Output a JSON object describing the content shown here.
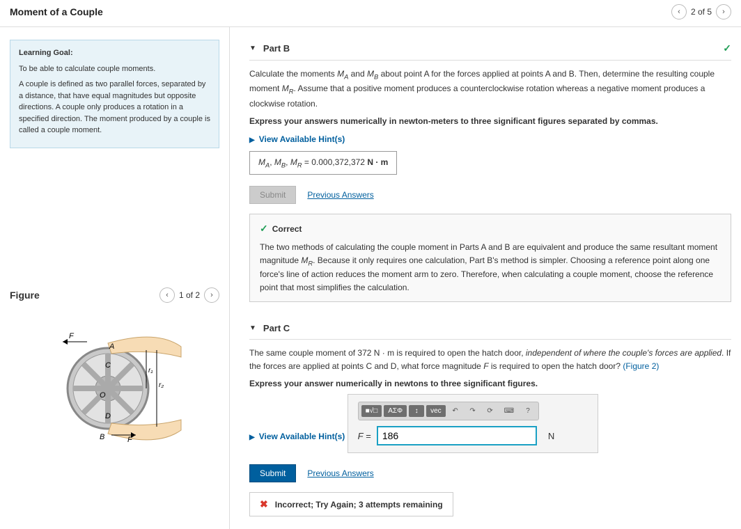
{
  "header": {
    "title": "Moment of a Couple",
    "pager": "2 of 5"
  },
  "learning_goal": {
    "title": "Learning Goal:",
    "goal": "To be able to calculate couple moments.",
    "desc": "A couple is defined as two parallel forces, separated by a distance, that have equal magnitudes but opposite directions. A couple only produces a rotation in a specified direction. The moment produced by a couple is called a couple moment."
  },
  "figure": {
    "title": "Figure",
    "pager": "1 of 2",
    "labels": {
      "F_top": "F",
      "A": "A",
      "C": "C",
      "O": "O",
      "D": "D",
      "B": "B",
      "F_bot": "F",
      "r1": "r₁",
      "r2": "r₂"
    }
  },
  "partB": {
    "label": "Part B",
    "instr_pre": "Calculate the moments ",
    "instr_mid1": " and ",
    "instr_mid2": " about point A for the forces applied at points A and B. Then, determine the resulting couple moment ",
    "instr_post": ". Assume that a positive moment produces a counterclockwise rotation whereas a negative moment produces a clockwise rotation.",
    "MA": "M",
    "MA_sub": "A",
    "MB": "M",
    "MB_sub": "B",
    "MR": "M",
    "MR_sub": "R",
    "express": "Express your answers numerically in newton-meters to three significant figures separated by commas.",
    "hints": "View Available Hint(s)",
    "answer_vars": "M",
    "answer_eq": " = 0.000,372,372 ",
    "answer_units": "N · m",
    "submit": "Submit",
    "prev": "Previous Answers",
    "feedback": {
      "title": "Correct",
      "body_pre": "The two methods of calculating the couple moment in Parts A and B are equivalent and produce the same resultant moment magnitude ",
      "body_post": ". Because it only requires one calculation, Part B's method is simpler. Choosing a reference point along one force's line of action reduces the moment arm to zero. Therefore, when calculating a couple moment, choose the reference point that most simplifies the calculation."
    }
  },
  "partC": {
    "label": "Part C",
    "instr_pre": "The same couple moment of 372 ",
    "instr_units": "N · m",
    "instr_mid1": " is required to open the hatch door, ",
    "instr_ital": "independent of where the couple's forces are applied",
    "instr_mid2": ". If the forces are applied at points C and D, what force magnitude ",
    "F": "F",
    "instr_post": " is required to open the hatch door? ",
    "fig_link": "(Figure 2)",
    "express": "Express your answer numerically in newtons to three significant figures.",
    "hints": "View Available Hint(s)",
    "toolbar": {
      "b1": "■√□",
      "b2": "ΑΣΦ",
      "b3": "↕",
      "b4": "vec",
      "undo": "↶",
      "redo": "↷",
      "reset": "⟳",
      "kbd": "⌨",
      "help": "?"
    },
    "var_label": "F",
    "eq": " = ",
    "input_value": "186",
    "unit": "N",
    "submit": "Submit",
    "prev": "Previous Answers",
    "incorrect": "Incorrect; Try Again; 3 attempts remaining"
  }
}
